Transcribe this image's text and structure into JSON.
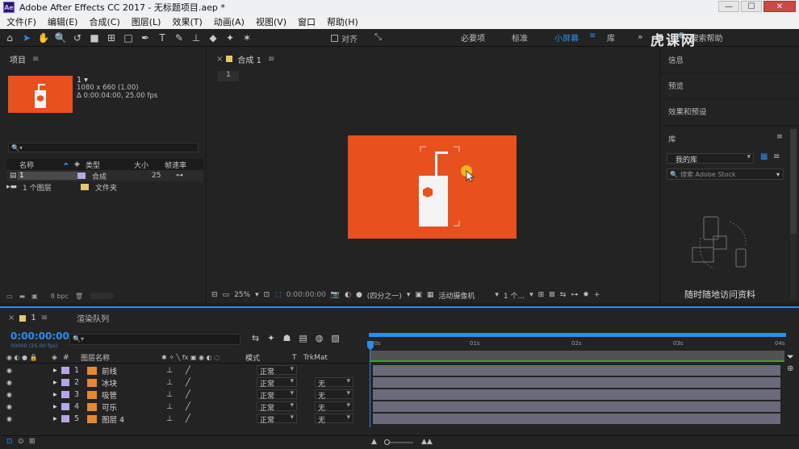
{
  "app": {
    "title": "Adobe After Effects CC 2017 - 无标题项目.aep *",
    "icon_label": "Ae"
  },
  "window_controls": {
    "minimize": "—",
    "maximize": "☐",
    "close": "✕"
  },
  "menu": [
    "文件(F)",
    "编辑(E)",
    "合成(C)",
    "图层(L)",
    "效果(T)",
    "动画(A)",
    "视图(V)",
    "窗口",
    "帮助(H)"
  ],
  "toolbar": {
    "snap_label": "对齐",
    "workspaces": [
      "必要项",
      "标准",
      "小屏幕",
      "库"
    ],
    "active_workspace": "小屏幕",
    "search_placeholder": "搜索帮助",
    "watermark": "虎课网"
  },
  "project_panel": {
    "title": "项目",
    "item_name": "1 ▾",
    "item_resolution": "1080 x 660 (1.00)",
    "item_duration": "Δ 0:00:04:00, 25.00 fps",
    "columns": [
      "名称",
      "类型",
      "大小",
      "帧速率"
    ],
    "rows": [
      {
        "name": "1",
        "type": "合成",
        "size": "",
        "fps": "25"
      },
      {
        "name": "1 个图层",
        "type": "文件夹",
        "size": "",
        "fps": ""
      }
    ],
    "bpc": "8 bpc"
  },
  "comp_panel": {
    "tab": "合成 1",
    "breadcrumb": "1",
    "zoom": "25%",
    "time": "0:00:00:00",
    "resolution": "(四分之一)",
    "camera": "活动摄像机",
    "views": "1 个..."
  },
  "right_panel": {
    "items": [
      "信息",
      "预览",
      "效果和预设"
    ],
    "library_title": "库",
    "library_select": "我的库",
    "stock_search": "搜索 Adobe Stock",
    "sync_message": "随时随地访问资料"
  },
  "timeline": {
    "tab": "1",
    "render_queue": "渲染队列",
    "time": "0:00:00:00",
    "time_sub": "00000 (25.00 fps)",
    "columns": {
      "layer_name": "图层名称",
      "mode": "模式",
      "t": "T",
      "trkmat": "TrkMat"
    },
    "ruler": [
      "00s",
      "01s",
      "02s",
      "03s",
      "04s"
    ],
    "layers": [
      {
        "num": "1",
        "name": "前线",
        "mode": "正常",
        "trkmat": ""
      },
      {
        "num": "2",
        "name": "冰块",
        "mode": "正常",
        "trkmat": "无"
      },
      {
        "num": "3",
        "name": "吸管",
        "mode": "正常",
        "trkmat": "无"
      },
      {
        "num": "4",
        "name": "可乐",
        "mode": "正常",
        "trkmat": "无"
      },
      {
        "num": "5",
        "name": "图层 4",
        "mode": "正常",
        "trkmat": "无"
      }
    ]
  },
  "colors": {
    "accent": "#2d8ceb",
    "comp_bg": "#e8501e",
    "label_lavender": "#b6a6e3"
  }
}
